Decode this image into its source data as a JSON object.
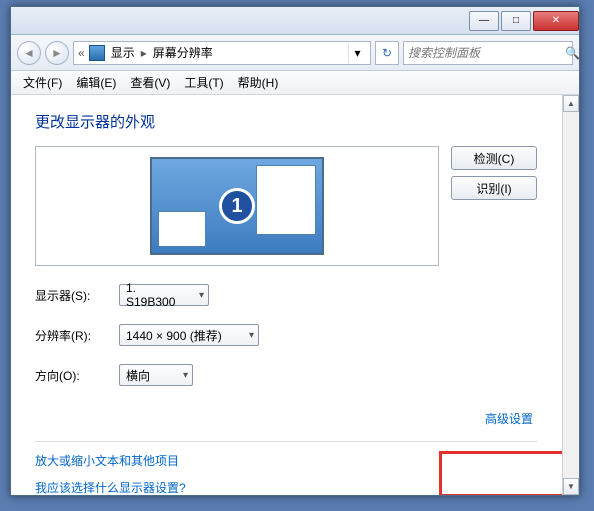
{
  "titlebar": {
    "min": "—",
    "max": "□",
    "close": "✕"
  },
  "nav": {
    "back": "◄",
    "forward": "►",
    "history_sep": "«",
    "bc_root": "显示",
    "bc_current": "屏幕分辨率",
    "refresh": "↻",
    "search_placeholder": "搜索控制面板",
    "search_icon": "🔍"
  },
  "menu": {
    "file": "文件(F)",
    "edit": "编辑(E)",
    "view": "查看(V)",
    "tools": "工具(T)",
    "help": "帮助(H)"
  },
  "page": {
    "heading": "更改显示器的外观",
    "monitor_number": "1",
    "detect_btn": "检测(C)",
    "identify_btn": "识别(I)",
    "display_label": "显示器(S):",
    "display_value": "1. S19B300",
    "resolution_label": "分辨率(R):",
    "resolution_value": "1440 × 900 (推荐)",
    "orientation_label": "方向(O):",
    "orientation_value": "横向",
    "advanced_link": "高级设置",
    "link_text_size": "放大或缩小文本和其他项目",
    "link_which_display": "我应该选择什么显示器设置?"
  }
}
